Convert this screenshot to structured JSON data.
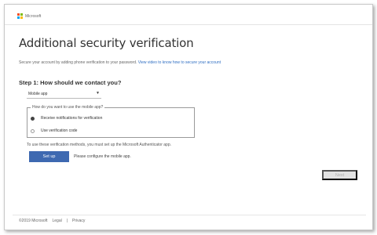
{
  "header": {
    "brand": "Microsoft"
  },
  "page": {
    "title": "Additional security verification",
    "intro_text": "Secure your account by adding phone verification to your password.",
    "intro_link": "View video to know how to secure your account"
  },
  "step1": {
    "heading": "Step 1: How should we contact you?",
    "contact_method": "Mobile app",
    "mobile_app_legend": "How do you want to use the mobile app?",
    "options": [
      {
        "label": "Receive notifications for verification",
        "selected": true
      },
      {
        "label": "Use verification code",
        "selected": false
      }
    ],
    "note": "To use these verification methods, you must set up the Microsoft Authenticator app.",
    "setup_label": "Set up",
    "configure_note": "Please configure the mobile app."
  },
  "actions": {
    "next_label": "Next"
  },
  "footer": {
    "copyright": "©2019 Microsoft",
    "legal": "Legal",
    "separator": "|",
    "privacy": "Privacy"
  },
  "colors": {
    "primary_button": "#3e69b1",
    "link": "#2f6ec2",
    "disabled_button": "#e2e2e2"
  },
  "icons": {
    "brand_logo": "microsoft-logo-icon",
    "dropdown": "chevron-down-icon"
  }
}
